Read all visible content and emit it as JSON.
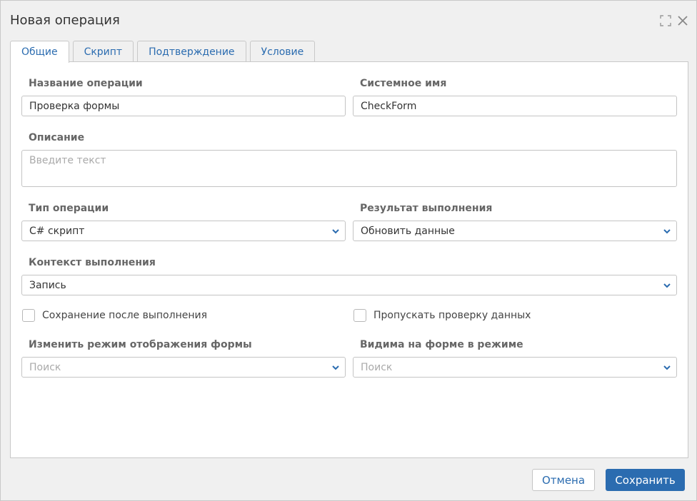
{
  "dialog": {
    "title": "Новая операция"
  },
  "tabs": [
    {
      "label": "Общие",
      "active": true
    },
    {
      "label": "Скрипт",
      "active": false
    },
    {
      "label": "Подтверждение",
      "active": false
    },
    {
      "label": "Условие",
      "active": false
    }
  ],
  "form": {
    "name": {
      "label": "Название операции",
      "value": "Проверка формы"
    },
    "system_name": {
      "label": "Системное имя",
      "value": "CheckForm"
    },
    "description": {
      "label": "Описание",
      "placeholder": "Введите текст"
    },
    "operation_type": {
      "label": "Тип операции",
      "value": "C# скрипт"
    },
    "result": {
      "label": "Результат выполнения",
      "value": "Обновить данные"
    },
    "context": {
      "label": "Контекст выполнения",
      "value": "Запись"
    },
    "save_after": {
      "label": "Сохранение после выполнения",
      "checked": false
    },
    "skip_validation": {
      "label": "Пропускать проверку данных",
      "checked": false
    },
    "change_mode": {
      "label": "Изменить режим отображения формы",
      "placeholder": "Поиск"
    },
    "visible_mode": {
      "label": "Видима на форме в режиме",
      "placeholder": "Поиск"
    }
  },
  "footer": {
    "cancel_label": "Отмена",
    "save_label": "Сохранить"
  },
  "colors": {
    "accent": "#2b6cb0",
    "border": "#c4c4c4",
    "background": "#f0f0f0"
  }
}
